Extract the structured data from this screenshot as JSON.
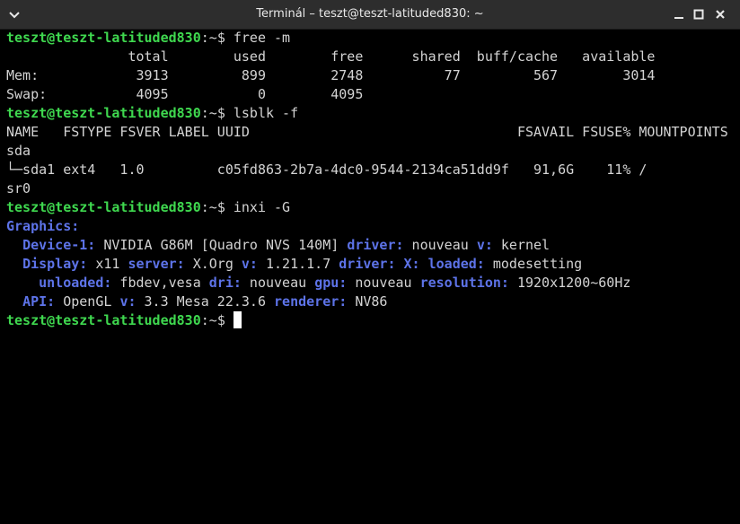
{
  "window": {
    "title": "Terminál – teszt@teszt-latituded830: ~"
  },
  "icons": {
    "menu": "chevron-down-icon",
    "minimize": "minimize-icon",
    "maximize": "maximize-icon",
    "close": "close-icon"
  },
  "colors": {
    "prompt": "#3fd84f",
    "key": "#5d73e8",
    "text": "#d3d3d3",
    "background": "#000000"
  },
  "terminal": {
    "prompt_user": "teszt@teszt-latituded830",
    "prompt_path": ":~",
    "prompt_sym": "$ ",
    "cmd_free": "free -m",
    "free_header": "               total        used        free      shared  buff/cache   available",
    "free_mem": "Mem:            3913         899        2748          77         567        3014",
    "free_swap": "Swap:           4095           0        4095",
    "cmd_lsblk": "lsblk -f",
    "lsblk_header": "NAME   FSTYPE FSVER LABEL UUID                                 FSAVAIL FSUSE% MOUNTPOINTS",
    "lsblk_sda": "sda",
    "lsblk_sda1": "└─sda1 ext4   1.0         c05fd863-2b7a-4dc0-9544-2134ca51dd9f   91,6G    11% /",
    "lsblk_sr0": "sr0",
    "cmd_inxi": "inxi -G",
    "graphics_label": "Graphics:",
    "device_label": "Device-1:",
    "device_value": " NVIDIA G86M [Quadro NVS 140M] ",
    "driver_label": "driver:",
    "device_driver": " nouveau ",
    "v_label": "v:",
    "device_v": " kernel",
    "display_label": "Display:",
    "display_value": " x11 ",
    "server_label": "server:",
    "server_value": " X.Org ",
    "server_v": " 1.21.1.7 ",
    "x_label": "X:",
    "loaded_label": "loaded:",
    "loaded_value": " modesetting",
    "unloaded_label": "unloaded:",
    "unloaded_value": " fbdev,vesa ",
    "dri_label": "dri:",
    "dri_value": " nouveau ",
    "gpu_label": "gpu:",
    "gpu_value": " nouveau ",
    "resolution_label": "resolution:",
    "resolution_value": " 1920x1200~60Hz",
    "api_label": "API:",
    "api_value": " OpenGL ",
    "api_v": " 3.3 Mesa 22.3.6 ",
    "renderer_label": "renderer:",
    "renderer_value": " NV86"
  }
}
